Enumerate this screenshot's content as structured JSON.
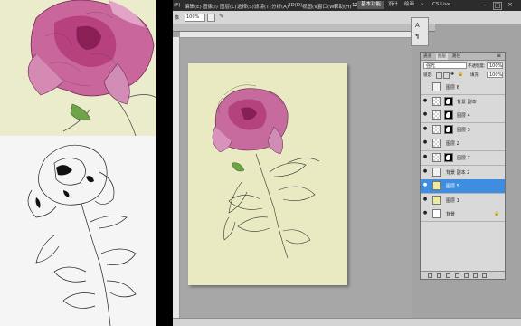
{
  "menubar": {
    "items": [
      "(F)",
      "编辑(E)",
      "图像(I)",
      "图层(L)",
      "选择(S)",
      "滤镜(T)",
      "分析(A)",
      "3D(D)",
      "视图(V)",
      "窗口(W)",
      "帮助(H)"
    ],
    "zoom_level": "12.5",
    "workspace_active": "基本功能",
    "workspace_design": "设计",
    "workspace_paint": "绘画",
    "more": "»",
    "cslive": "CS Live"
  },
  "options": {
    "zoom_label": "像",
    "zoom_value": "100%"
  },
  "layers_panel": {
    "tabs": [
      "通道",
      "图层",
      "路径"
    ],
    "blend_mode": "强光",
    "opacity_label": "不透明度:",
    "opacity_value": "100%",
    "lock_label": "锁定:",
    "fill_label": "填充:",
    "fill_value": "100%",
    "layers": [
      {
        "name": "图层 6",
        "eye": "",
        "thumb": "sketch",
        "mask": false,
        "lock": ""
      },
      {
        "name": "背景 副本",
        "eye": "●",
        "thumb": "checker",
        "mask": true,
        "lock": ""
      },
      {
        "name": "图层 4",
        "eye": "●",
        "thumb": "checker",
        "mask": true,
        "lock": ""
      },
      {
        "name": "图层 3",
        "eye": "●",
        "thumb": "checker",
        "mask": true,
        "lock": ""
      },
      {
        "name": "图层 2",
        "eye": "●",
        "thumb": "checker",
        "mask": false,
        "lock": ""
      },
      {
        "name": "图层 7",
        "eye": "●",
        "thumb": "checker",
        "mask": true,
        "lock": ""
      },
      {
        "name": "背景 副本 2",
        "eye": "●",
        "thumb": "sketch",
        "mask": false,
        "lock": ""
      },
      {
        "name": "图层 5",
        "eye": "●",
        "thumb": "yellow",
        "mask": false,
        "lock": "",
        "selected": true
      },
      {
        "name": "图层 1",
        "eye": "●",
        "thumb": "yellow",
        "mask": false,
        "lock": ""
      },
      {
        "name": "背景",
        "eye": "●",
        "thumb": "white",
        "mask": false,
        "lock": "🔒"
      }
    ]
  },
  "colors": {
    "menubar_bg": "#2c2c2c",
    "selected_layer": "#3e8de0",
    "workspace_active_bg": "#585858",
    "document_bg": "#eaeac4"
  }
}
